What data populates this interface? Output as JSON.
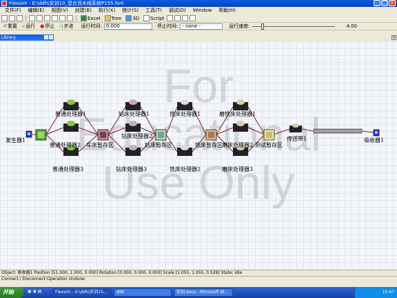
{
  "window": {
    "title": "Flexsim - E:\\ddh\\实训10_混合流水线系统P155.fsm"
  },
  "menu": [
    "文件(F)",
    "编辑(E)",
    "视图(V)",
    "创建(B)",
    "执行(X)",
    "统计(S)",
    "工具(T)",
    "调试(D)",
    "Window",
    "帮助(H)"
  ],
  "toolbar": {
    "excel": "Excel",
    "tree": "Tree",
    "three_d": "3D",
    "script": "Script"
  },
  "run_controls": {
    "reset": "重置",
    "run": "运行",
    "stop": "停止",
    "step": "步进",
    "run_time_label": "运行时间:",
    "run_time_value": "0.000",
    "stop_time_label": "停止时间:",
    "stop_time_value": "- none -",
    "run_speed_label": "运行速度:",
    "run_speed_value": "4.00",
    "run_speed_fraction": 0.12
  },
  "library": {
    "title": "Library"
  },
  "watermark": "For\nEducational\nUse Only",
  "model": {
    "labels": {
      "source": "发生器1",
      "ordinary1": "普通处理器1",
      "ordinary2": "普通处理器2",
      "ordinary3": "普通处理器3",
      "lathe_buffer": "车床暂存区",
      "drill1": "钻床处理器1",
      "drill2": "钻床处理器2",
      "drill3": "钻床处理器3",
      "drill_buffer": "钻床暂存区",
      "mill1": "铣床处理器1",
      "mill2": "铣床处理器2",
      "mill_buffer": "铣床暂存区",
      "grind1": "磨铣床处理器1",
      "grind2": "磨床处理器2",
      "grind3": "磨床处理器3",
      "test_buffer": "测试暂存区",
      "conveyor": "传送带1",
      "sink": "吸收器1"
    },
    "colors": {
      "processor_green": "#8bc34a",
      "processor_pink": "#c9a9c9",
      "buffer_green": "#5fa83a",
      "sink": "#2b2bd6"
    }
  },
  "status": {
    "object_info": "Object: 吸收器1 Position [51.000, 1.000, 0.000] Rotation [0.000, 0.000, 0.000] Scale [1.055, 1.055, 0.528] State: idle",
    "output": "Connect / Disconnect Operation Undone"
  },
  "taskbar": {
    "start": "开始",
    "tasks": [
      "Flexsim - E:\\ddh\\实训10...",
      "ddh",
      "实训.docx - Microsoft W..."
    ],
    "clock": "15:47"
  }
}
